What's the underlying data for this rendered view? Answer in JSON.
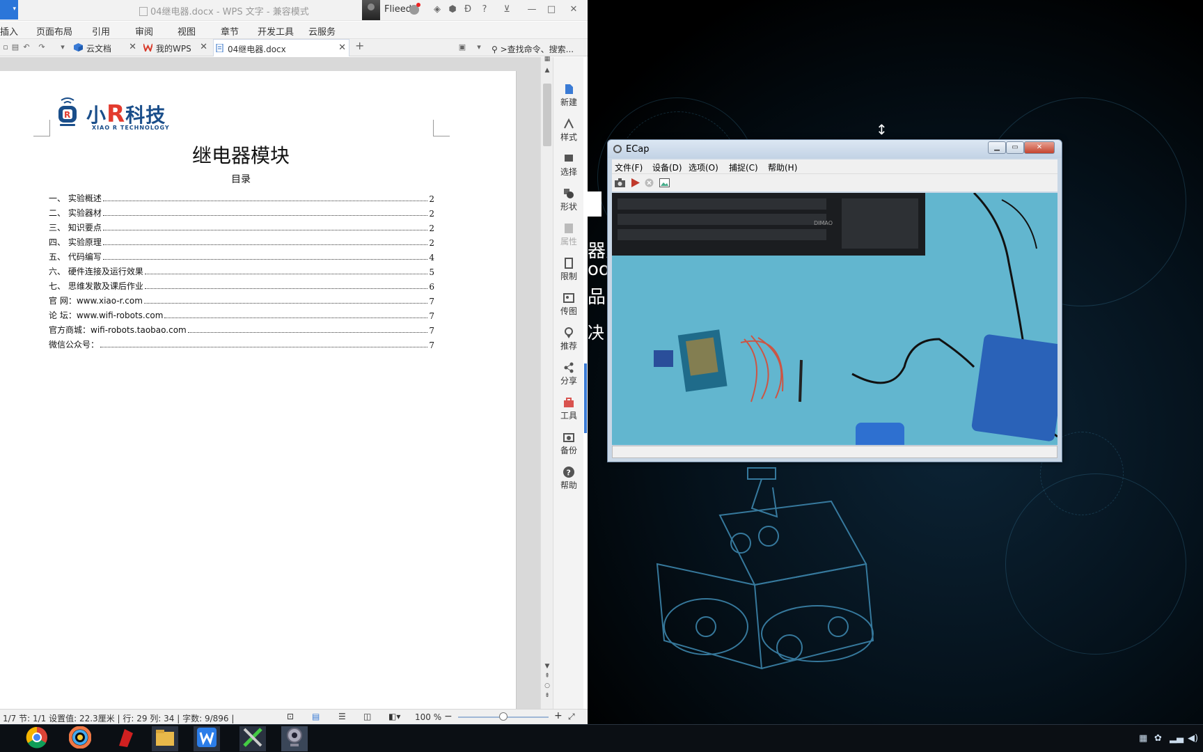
{
  "wps": {
    "title": "04继电器.docx - WPS 文字 - 兼容模式",
    "user_name": "Flieed",
    "menu": [
      "插入",
      "页面布局",
      "引用",
      "审阅",
      "视图",
      "章节",
      "开发工具",
      "云服务"
    ],
    "tabs": [
      {
        "label": "云文档"
      },
      {
        "label": "我的WPS"
      },
      {
        "label": "04继电器.docx"
      }
    ],
    "search_placeholder": ">查找命令、搜索..."
  },
  "document": {
    "logo_text_a": "小",
    "logo_text_r": "R",
    "logo_text_b": "科技",
    "logo_sub": "XIAO R TECHNOLOGY",
    "heading": "继电器模块",
    "toc_title": "目录",
    "toc": [
      {
        "label": "一、 实验概述",
        "page": "2"
      },
      {
        "label": "二、 实验器材",
        "page": "2"
      },
      {
        "label": "三、 知识要点",
        "page": "2"
      },
      {
        "label": "四、 实验原理",
        "page": "2"
      },
      {
        "label": "五、 代码编写",
        "page": "4"
      },
      {
        "label": "六、 硬件连接及运行效果",
        "page": "5"
      },
      {
        "label": "七、 思维发散及课后作业",
        "page": "6"
      },
      {
        "label": "官 网：www.xiao-r.com",
        "page": "7"
      },
      {
        "label": "论 坛：www.wifi-robots.com",
        "page": "7"
      },
      {
        "label": "官方商城：wifi-robots.taobao.com",
        "page": "7"
      },
      {
        "label": "微信公众号：",
        "page": "7"
      }
    ]
  },
  "side_panel": [
    "新建",
    "样式",
    "选择",
    "形状",
    "属性",
    "限制",
    "传图",
    "推荐",
    "分享",
    "工具",
    "备份",
    "帮助"
  ],
  "status": {
    "text": "1/7  节: 1/1  设置值: 22.3厘米 | 行: 29  列: 34 | 字数: 9/896 |",
    "zoom": "100 %",
    "zoom_level_percent": 50
  },
  "ecap": {
    "title": "ECap",
    "menu": [
      "文件(F)",
      "设备(D)",
      "选项(O)",
      "捕捉(C)",
      "帮助(H)"
    ],
    "keyboard_brand": "DIMAO"
  },
  "desktop": {
    "side_text": [
      "器人",
      "oo",
      "品",
      "决"
    ]
  },
  "taskbar": {
    "apps": [
      "chrome-icon",
      "color-picker-icon",
      "red-app-icon",
      "file-explorer-icon",
      "wps-writer-icon",
      "tools-icon",
      "webcam-icon"
    ]
  }
}
